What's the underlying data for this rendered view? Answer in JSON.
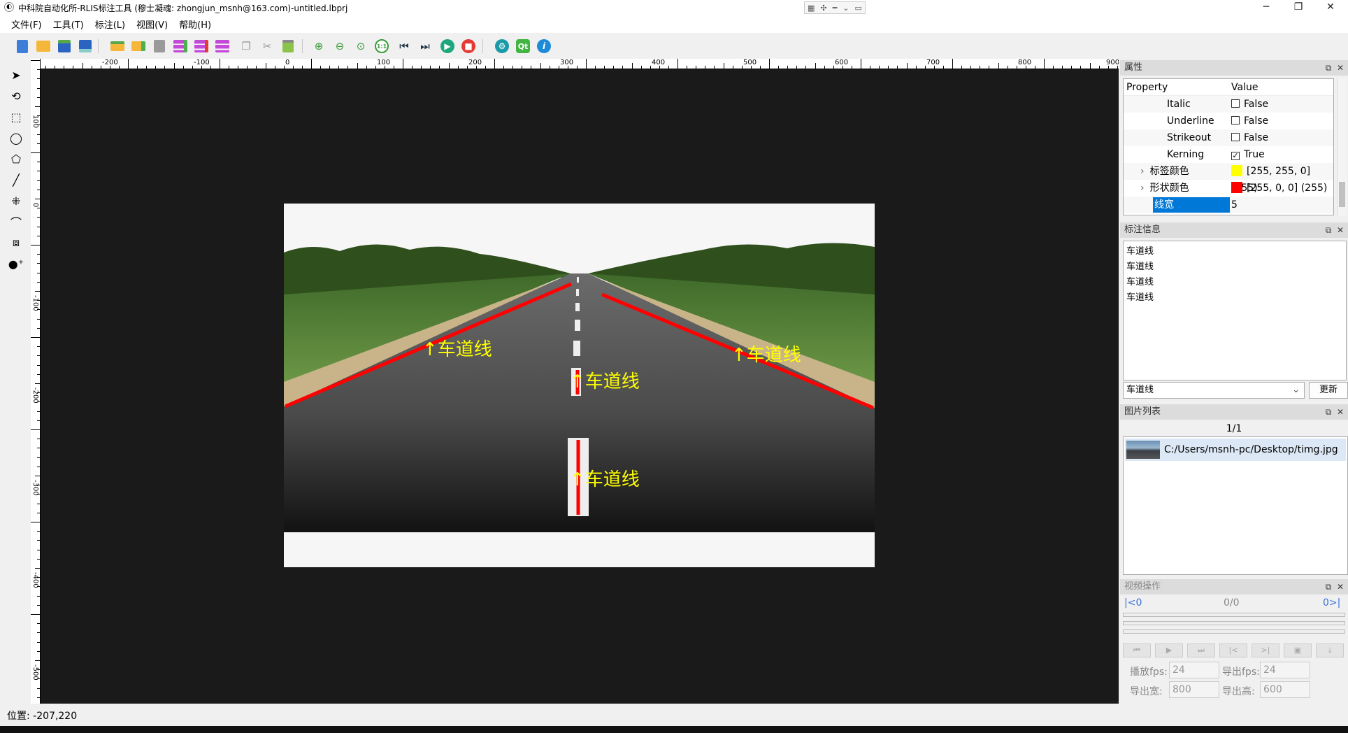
{
  "window": {
    "title": "中科院自动化所-RLIS标注工具 (穆士凝魂: zhongjun_msnh@163.com)-untitled.lbprj",
    "minimize": "─",
    "restore": "❐",
    "close": "✕"
  },
  "menu": [
    "文件(F)",
    "工具(T)",
    "标注(L)",
    "视图(V)",
    "帮助(H)"
  ],
  "toolbar": {
    "icons": [
      "new-file-icon",
      "open-folder-icon",
      "save-icon",
      "save-as-icon",
      "open-dir-icon",
      "add-folder-icon",
      "export-icon",
      "add-layer-icon",
      "remove-layer-icon",
      "layers-icon",
      "copy-icon",
      "cut-icon",
      "paste-icon",
      "zoom-in-icon",
      "zoom-out-icon",
      "zoom-fit-icon",
      "zoom-1to1-icon",
      "prev-image-icon",
      "next-image-icon",
      "play-icon",
      "stop-icon",
      "settings-icon",
      "qt-icon",
      "info-icon"
    ],
    "zoom_1to1": "1:1",
    "qt": "Qt",
    "info": "i"
  },
  "tools": [
    "select-arrow-icon",
    "rotate-icon",
    "rectangle-tool-icon",
    "ellipse-tool-icon",
    "polygon-tool-icon",
    "line-tool-icon",
    "keypoints-tool-icon",
    "bezier-tool-icon",
    "rotated-rect-tool-icon",
    "point-add-tool-icon"
  ],
  "ruler": {
    "h_labels": [
      "-200",
      "-100",
      "0",
      "100",
      "200",
      "300",
      "400",
      "500",
      "600",
      "700",
      "800",
      "900"
    ],
    "v_labels": [
      "100",
      "0",
      "-100",
      "-200",
      "-300",
      "-400",
      "-500"
    ]
  },
  "canvas": {
    "labels": [
      "车道线",
      "车道线",
      "车道线",
      "车道线"
    ],
    "line_color": "#ff0000",
    "label_color": "#ffff00"
  },
  "properties": {
    "title": "属性",
    "col_property": "Property",
    "col_value": "Value",
    "rows": [
      {
        "name": "Italic",
        "value": "False",
        "checked": false
      },
      {
        "name": "Underline",
        "value": "False",
        "checked": false
      },
      {
        "name": "Strikeout",
        "value": "False",
        "checked": false
      },
      {
        "name": "Kerning",
        "value": "True",
        "checked": true
      }
    ],
    "label_color_name": "标签颜色",
    "label_color_value": "[255, 255, 0] (255)",
    "label_color_hex": "#ffff00",
    "shape_color_name": "形状颜色",
    "shape_color_value": "[255, 0, 0] (255)",
    "shape_color_hex": "#ff0000",
    "line_width_name": "线宽",
    "line_width_value": "5",
    "expand": "›",
    "check_mark": "✓"
  },
  "annotation_info": {
    "title": "标注信息",
    "items": [
      "车道线",
      "车道线",
      "车道线",
      "车道线"
    ],
    "selected_label": "车道线",
    "update_button": "更新"
  },
  "image_list": {
    "title": "图片列表",
    "count": "1/1",
    "items": [
      "C:/Users/msnh-pc/Desktop/timg.jpg"
    ]
  },
  "video": {
    "title": "视频操作",
    "start": "|<0",
    "progress": "0/0",
    "end": "0>|",
    "play_fps_label": "播放fps:",
    "play_fps_value": "24",
    "export_fps_label": "导出fps:",
    "export_fps_value": "24",
    "export_width_label": "导出宽:",
    "export_width_value": "800",
    "export_height_label": "导出高:",
    "export_height_value": "600"
  },
  "panel_buttons": {
    "float": "⧉",
    "close": "✕"
  },
  "status": {
    "position": "位置: -207,220"
  }
}
